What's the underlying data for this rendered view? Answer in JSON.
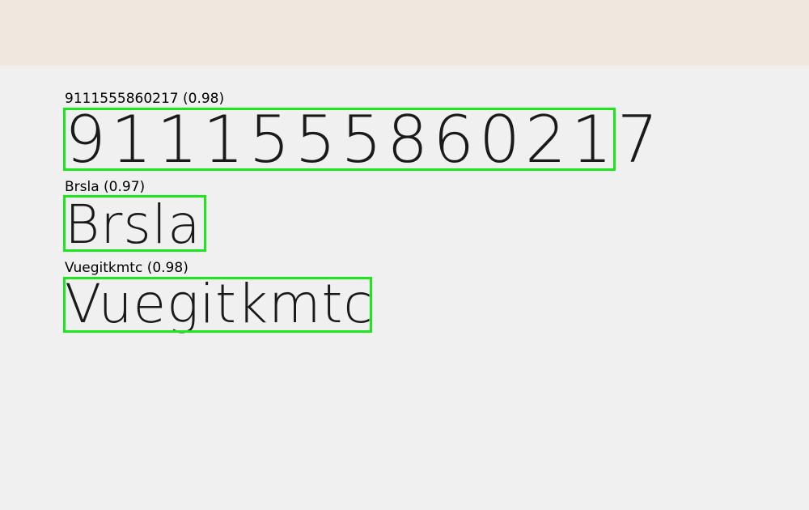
{
  "detections": [
    {
      "label": "9111555860217 (0.98)",
      "text": "9111555860217"
    },
    {
      "label": "Brsla (0.97)",
      "text": "Brsla"
    },
    {
      "label": "Vuegitkmtc (0.98)",
      "text": "Vuegitkmtc"
    }
  ],
  "colors": {
    "box": "#1ee61e",
    "background": "#f0f0f0",
    "top_band": "#f0e7de"
  }
}
